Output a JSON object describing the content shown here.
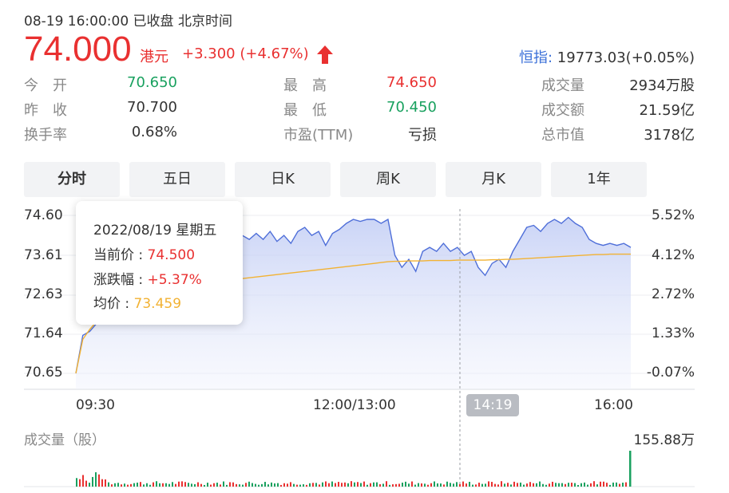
{
  "header": {
    "status": "08-19 16:00:00  已收盘  北京时间",
    "price": "74.000",
    "currency": "港元",
    "change": "+3.300 (+4.67%)",
    "index_label": "恒指:",
    "index_value": "19773.03(+0.05%)"
  },
  "quotes": [
    {
      "label": "今　开",
      "value": "70.650",
      "color": "#19a15f"
    },
    {
      "label": "最　高",
      "value": "74.650",
      "color": "#e93030"
    },
    {
      "label": "成交量",
      "value": "2934万股",
      "color": "#333333"
    },
    {
      "label": "昨　收",
      "value": "70.700",
      "color": "#333333"
    },
    {
      "label": "最　低",
      "value": "70.450",
      "color": "#19a15f"
    },
    {
      "label": "成交额",
      "value": "21.59亿",
      "color": "#333333"
    },
    {
      "label": "换手率",
      "value": "0.68%",
      "color": "#333333"
    },
    {
      "label": "市盈(TTM)",
      "value": "亏损",
      "color": "#333333"
    },
    {
      "label": "总市值",
      "value": "3178亿",
      "color": "#333333"
    }
  ],
  "tabs": [
    "分时",
    "五日",
    "日K",
    "周K",
    "月K",
    "1年"
  ],
  "active_tab": "分时",
  "chart_data": {
    "type": "line",
    "y_price_ticks": [
      "74.60",
      "73.61",
      "72.63",
      "71.64",
      "70.65"
    ],
    "y_pct_ticks": [
      "5.52%",
      "4.12%",
      "2.72%",
      "1.33%",
      "-0.07%"
    ],
    "x_ticks": [
      "09:30",
      "12:00/13:00",
      "16:00"
    ],
    "crosshair_time": "14:19",
    "ylim": [
      70.65,
      74.6
    ],
    "series": [
      {
        "name": "当前价",
        "color": "#4f6fd9",
        "values": [
          70.65,
          71.6,
          71.7,
          71.9,
          72.0,
          72.3,
          72.6,
          72.9,
          73.1,
          73.2,
          73.3,
          73.4,
          73.5,
          73.6,
          73.7,
          73.6,
          73.8,
          73.5,
          73.9,
          73.7,
          73.9,
          73.8,
          74.0,
          73.9,
          74.1,
          74.0,
          74.15,
          74.0,
          74.2,
          73.95,
          74.1,
          73.9,
          74.2,
          74.3,
          74.1,
          74.2,
          73.85,
          74.15,
          74.25,
          74.4,
          74.5,
          74.45,
          74.5,
          74.5,
          74.4,
          74.5,
          73.6,
          73.3,
          73.5,
          73.2,
          73.7,
          73.8,
          73.7,
          73.9,
          73.7,
          73.8,
          73.6,
          73.7,
          73.3,
          73.1,
          73.4,
          73.5,
          73.3,
          73.7,
          74.0,
          74.3,
          74.35,
          74.2,
          74.4,
          74.5,
          74.4,
          74.55,
          74.4,
          74.3,
          74.0,
          73.9,
          73.85,
          73.9,
          73.85,
          73.9,
          73.8
        ]
      },
      {
        "name": "均价",
        "color": "#f2b233",
        "values": [
          70.65,
          71.5,
          71.75,
          71.95,
          72.1,
          72.25,
          72.35,
          72.45,
          72.52,
          72.58,
          72.63,
          72.67,
          72.7,
          72.73,
          72.76,
          72.79,
          72.82,
          72.85,
          72.88,
          72.9,
          72.93,
          72.95,
          72.98,
          73.0,
          73.02,
          73.04,
          73.06,
          73.08,
          73.1,
          73.12,
          73.14,
          73.16,
          73.18,
          73.2,
          73.22,
          73.24,
          73.26,
          73.28,
          73.3,
          73.32,
          73.34,
          73.36,
          73.38,
          73.4,
          73.42,
          73.44,
          73.45,
          73.45,
          73.46,
          73.46,
          73.46,
          73.47,
          73.47,
          73.47,
          73.47,
          73.48,
          73.48,
          73.48,
          73.48,
          73.48,
          73.49,
          73.49,
          73.5,
          73.5,
          73.51,
          73.52,
          73.53,
          73.54,
          73.55,
          73.56,
          73.57,
          73.58,
          73.59,
          73.6,
          73.61,
          73.62,
          73.62,
          73.63,
          73.63,
          73.63,
          73.63
        ]
      }
    ],
    "volume_label": "成交量（股）",
    "volume_max_label": "155.88万",
    "volume_last": 155.88
  },
  "tooltip": {
    "date": "2022/08/19 星期五",
    "price_label": "当前价 : ",
    "price_value": "74.500",
    "pct_label": "涨跌幅 : ",
    "pct_value": "+5.37%",
    "avg_label": "均价 : ",
    "avg_value": "73.459"
  }
}
